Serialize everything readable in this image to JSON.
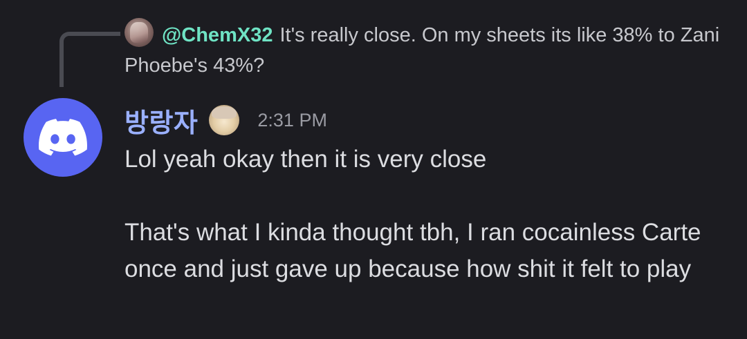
{
  "reply": {
    "mention": "@ChemX32",
    "text": "It's really close. On my sheets its like 38% to Zani Phoebe's 43%?"
  },
  "message": {
    "author": "방랑자",
    "timestamp": "2:31 PM",
    "lines": [
      "Lol yeah okay then it is very close",
      "That's what I kinda thought tbh, I ran cocainless Carte once and just gave up because how shit it felt to play"
    ]
  },
  "colors": {
    "background": "#1c1c21",
    "mention": "#6fe3c4",
    "author": "#9ab0ff",
    "discord_blurple": "#5865f2"
  },
  "icons": {
    "avatar": "discord-logo-icon",
    "reply_avatar": "user-avatar-icon",
    "badge": "profile-badge-icon"
  }
}
